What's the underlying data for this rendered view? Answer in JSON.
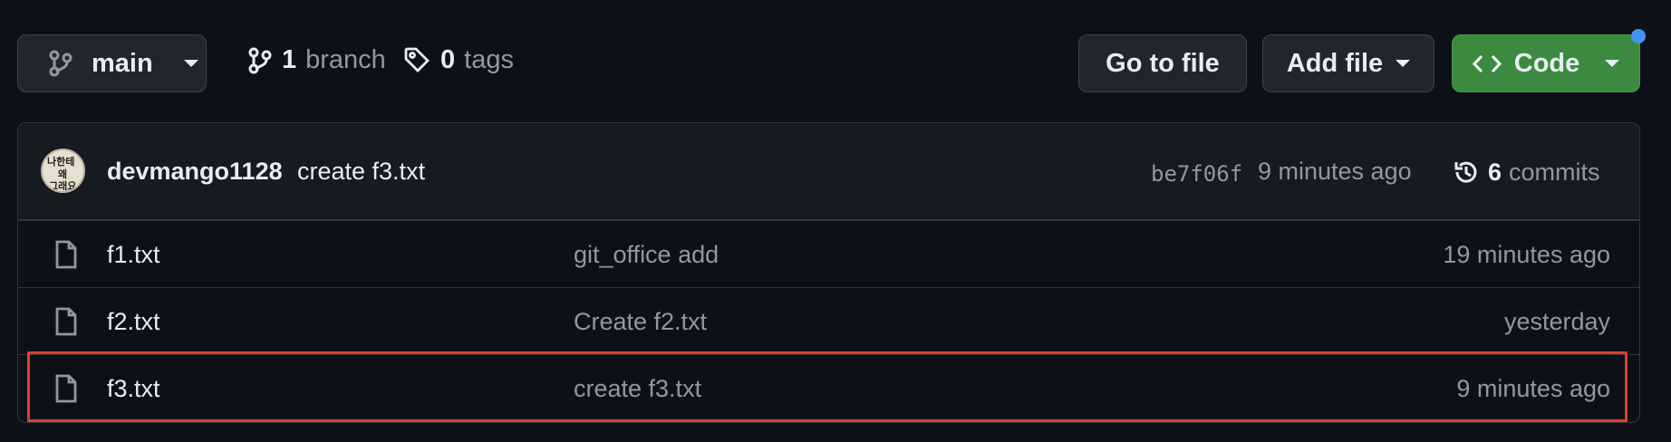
{
  "repo_bar": {
    "branch": "main",
    "branch_count": "1",
    "branch_label": "branch",
    "tag_count": "0",
    "tag_label": "tags",
    "go_to_file": "Go to file",
    "add_file": "Add file",
    "code": "Code"
  },
  "latest_commit": {
    "author": "devmango1128",
    "message": "create f3.txt",
    "sha": "be7f06f",
    "time": "9 minutes ago",
    "commit_count": "6",
    "commit_label": "commits"
  },
  "files": [
    {
      "name": "f1.txt",
      "message": "git_office add",
      "time": "19 minutes ago"
    },
    {
      "name": "f2.txt",
      "message": "Create f2.txt",
      "time": "yesterday"
    },
    {
      "name": "f3.txt",
      "message": "create f3.txt",
      "time": "9 minutes ago"
    }
  ],
  "colors": {
    "background": "#0d1117",
    "code_button": "#3b8a3f",
    "highlight": "#df3e2e",
    "notification_dot": "#4493f8"
  },
  "icons": {
    "branch": "git-branch-icon",
    "tag": "tag-icon",
    "code": "code-icon",
    "history": "history-icon",
    "file": "file-icon"
  }
}
